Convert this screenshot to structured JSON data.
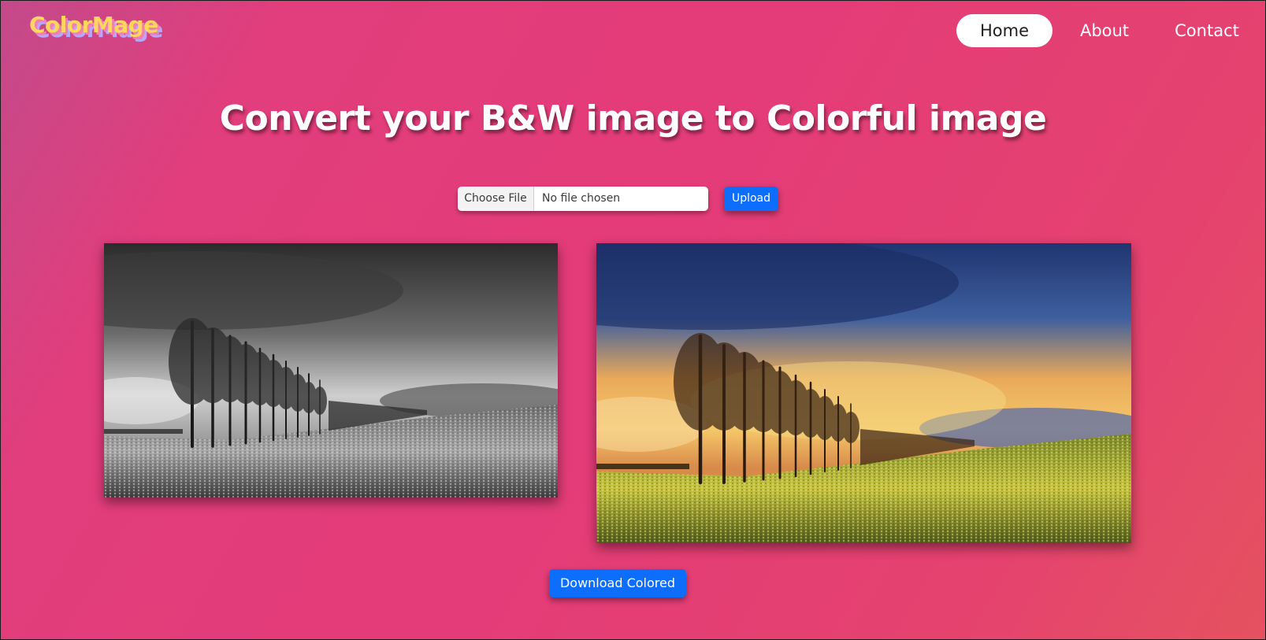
{
  "brand": {
    "name": "ColorMage"
  },
  "nav": {
    "items": [
      "Home",
      "About",
      "Contact"
    ],
    "active": "Home"
  },
  "main": {
    "title": "Convert your B&W image to Colorful image",
    "file_input": {
      "button_label": "Choose File",
      "status": "No file chosen"
    },
    "upload_label": "Upload",
    "download_label": "Download Colored"
  },
  "colors": {
    "accent": "#0d6efd",
    "logo": "#ffd75e"
  }
}
